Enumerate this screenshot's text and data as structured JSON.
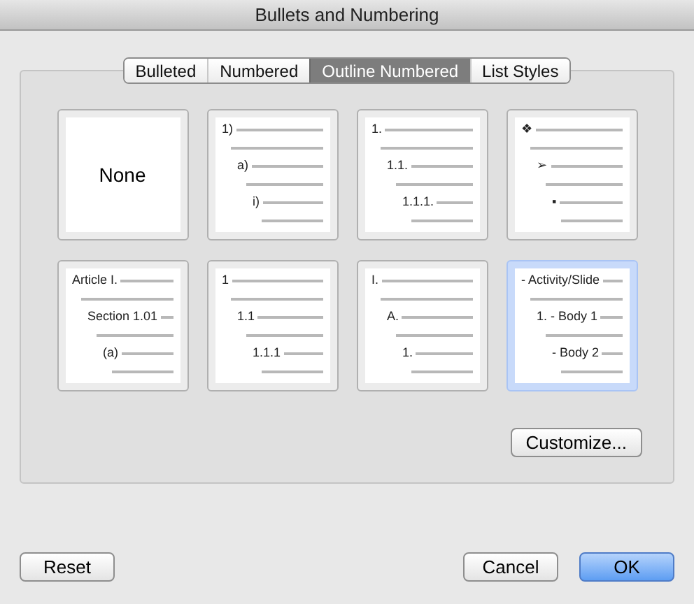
{
  "window": {
    "title": "Bullets and Numbering"
  },
  "tabs": [
    {
      "label": "Bulleted",
      "selected": false
    },
    {
      "label": "Numbered",
      "selected": false
    },
    {
      "label": "Outline Numbered",
      "selected": true
    },
    {
      "label": "List Styles",
      "selected": false
    }
  ],
  "tiles": [
    {
      "kind": "none",
      "label": "None",
      "selected": false
    },
    {
      "kind": "outline",
      "selected": false,
      "levels": [
        {
          "marker": "1)",
          "children": [
            {
              "marker": "a)",
              "children": [
                {
                  "marker": "i)"
                }
              ]
            }
          ]
        }
      ]
    },
    {
      "kind": "outline",
      "selected": false,
      "levels": [
        {
          "marker": "1.",
          "children": [
            {
              "marker": "1.1.",
              "children": [
                {
                  "marker": "1.1.1."
                }
              ]
            }
          ]
        }
      ]
    },
    {
      "kind": "outline",
      "selected": false,
      "levels": [
        {
          "marker": "❖",
          "children": [
            {
              "marker": "➢",
              "children": [
                {
                  "marker": "▪"
                }
              ]
            }
          ]
        }
      ]
    },
    {
      "kind": "outline",
      "selected": false,
      "levels": [
        {
          "marker": "Article I.",
          "children": [
            {
              "marker": "Section 1.01",
              "children": [
                {
                  "marker": "(a)"
                }
              ]
            }
          ]
        }
      ]
    },
    {
      "kind": "outline",
      "selected": false,
      "levels": [
        {
          "marker": "1",
          "children": [
            {
              "marker": "1.1",
              "children": [
                {
                  "marker": "1.1.1"
                }
              ]
            }
          ]
        }
      ]
    },
    {
      "kind": "outline",
      "selected": false,
      "levels": [
        {
          "marker": "I.",
          "children": [
            {
              "marker": "A.",
              "children": [
                {
                  "marker": "1."
                }
              ]
            }
          ]
        }
      ]
    },
    {
      "kind": "outline",
      "selected": true,
      "levels": [
        {
          "marker": "- Activity/Slide",
          "children": [
            {
              "marker": "1. - Body 1",
              "children": [
                {
                  "marker": "- Body 2"
                }
              ]
            }
          ]
        }
      ]
    }
  ],
  "customize_button": "Customize...",
  "buttons": [
    {
      "label": "Reset",
      "kind": "plain"
    },
    {
      "label": "Cancel",
      "kind": "plain"
    },
    {
      "label": "OK",
      "kind": "default"
    }
  ]
}
